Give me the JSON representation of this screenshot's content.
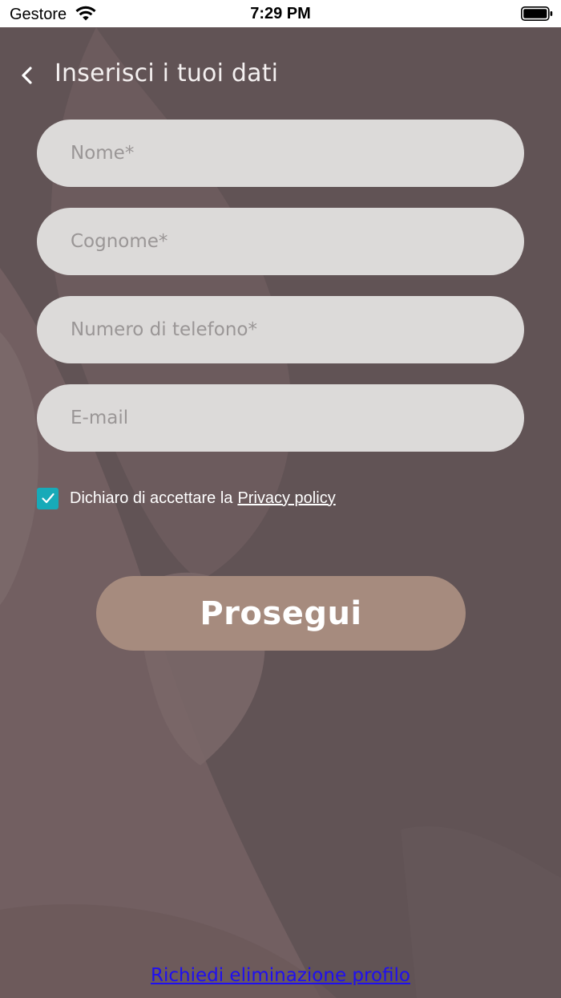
{
  "status_bar": {
    "carrier": "Gestore",
    "time": "7:29 PM"
  },
  "header": {
    "title": "Inserisci i tuoi dati",
    "back_icon": "chevron-left-icon"
  },
  "form": {
    "fields": [
      {
        "placeholder": "Nome*",
        "value": ""
      },
      {
        "placeholder": "Cognome*",
        "value": ""
      },
      {
        "placeholder": "Numero di telefono*",
        "value": ""
      },
      {
        "placeholder": "E-mail",
        "value": ""
      }
    ],
    "consent": {
      "checked": true,
      "text": "Dichiaro di accettare la",
      "link_label": "Privacy policy"
    },
    "submit_label": "Prosegui"
  },
  "footer": {
    "delete_profile_label": "Richiedi eliminazione profilo"
  },
  "colors": {
    "overlay": "#615355",
    "field_background": "#dcdad9",
    "checkbox_accent": "#17aab8",
    "button_background": "#a68b7e",
    "link": "#1f0ff0"
  }
}
